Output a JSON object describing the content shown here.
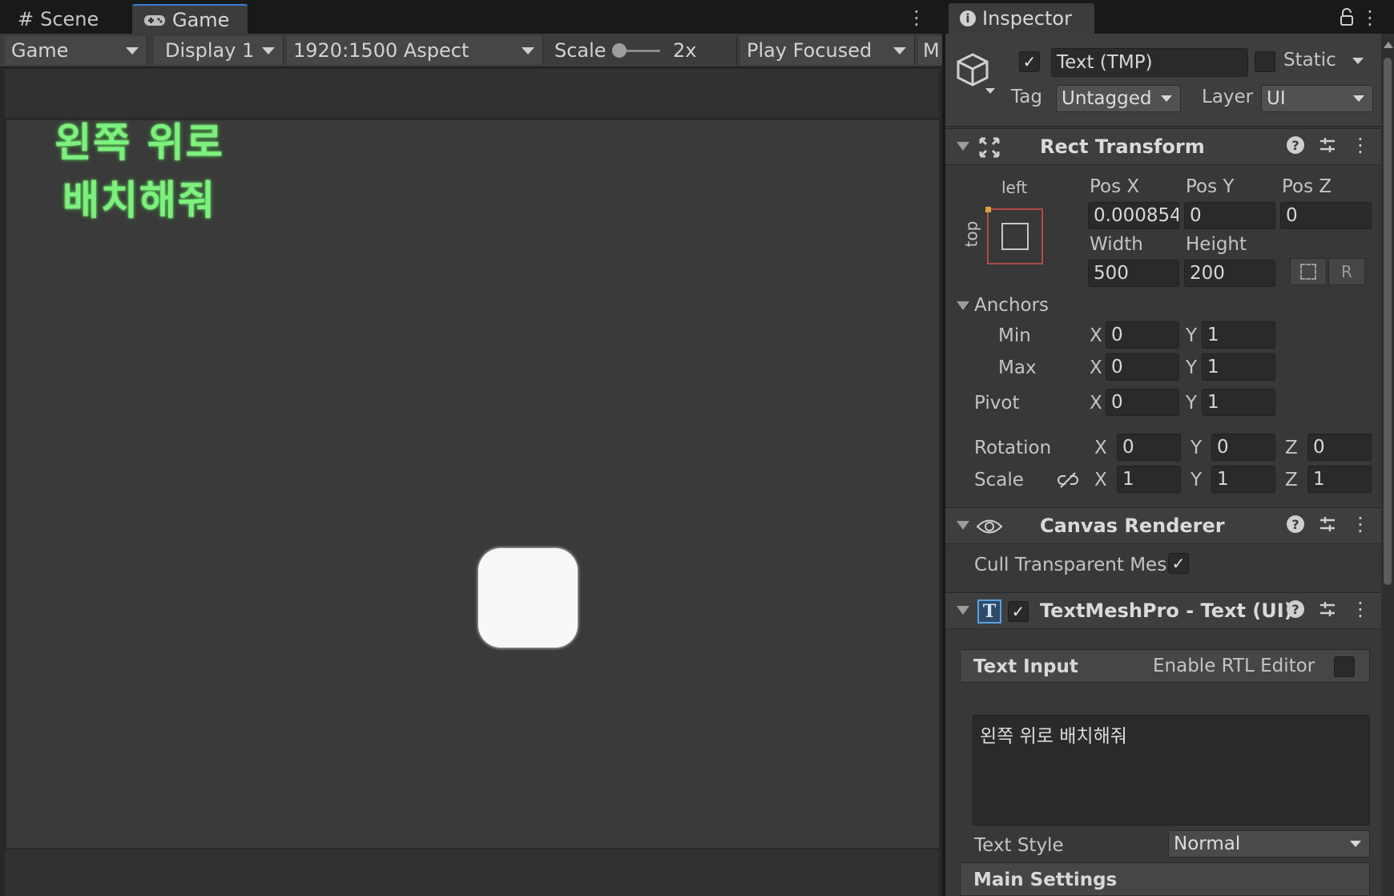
{
  "tabs": {
    "scene": "Scene",
    "game": "Game"
  },
  "toolbar": {
    "view_mode": "Game",
    "display": "Display 1",
    "aspect": "1920:1500 Aspect",
    "scale_label": "Scale",
    "scale_value": "2x",
    "play_mode": "Play Focused",
    "overflow": "M"
  },
  "game": {
    "text_line1": "왼쪽 위로",
    "text_line2": "배치해줘"
  },
  "inspector": {
    "tab": "Inspector",
    "object_name": "Text (TMP)",
    "static_label": "Static",
    "tag_label": "Tag",
    "tag_value": "Untagged",
    "layer_label": "Layer",
    "layer_value": "UI"
  },
  "rect_transform": {
    "title": "Rect Transform",
    "anchor_h": "left",
    "anchor_v": "top",
    "pos_x_label": "Pos X",
    "pos_x": "0.000854",
    "pos_y_label": "Pos Y",
    "pos_y": "0",
    "pos_z_label": "Pos Z",
    "pos_z": "0",
    "width_label": "Width",
    "width": "500",
    "height_label": "Height",
    "height": "200",
    "raw_btn": "R",
    "anchors_label": "Anchors",
    "min_label": "Min",
    "min_x": "0",
    "min_y": "1",
    "max_label": "Max",
    "max_x": "0",
    "max_y": "1",
    "pivot_label": "Pivot",
    "pivot_x": "0",
    "pivot_y": "1",
    "rotation_label": "Rotation",
    "rot_x": "0",
    "rot_y": "0",
    "rot_z": "0",
    "scale_label": "Scale",
    "scale_x": "1",
    "scale_y": "1",
    "scale_z": "1",
    "x": "X",
    "y": "Y",
    "z": "Z"
  },
  "canvas_renderer": {
    "title": "Canvas Renderer",
    "cull_label": "Cull Transparent Mes"
  },
  "tmp": {
    "title": "TextMeshPro - Text (UI)",
    "text_input_label": "Text Input",
    "rtl_label": "Enable RTL Editor",
    "text_value": "왼쪽 위로 배치해줘",
    "text_style_label": "Text Style",
    "text_style_value": "Normal",
    "main_settings": "Main Settings"
  },
  "colors": {
    "accent": "#3a7bd5",
    "game_text": "#7ef07e",
    "anchor_frame": "#b04a4a"
  }
}
